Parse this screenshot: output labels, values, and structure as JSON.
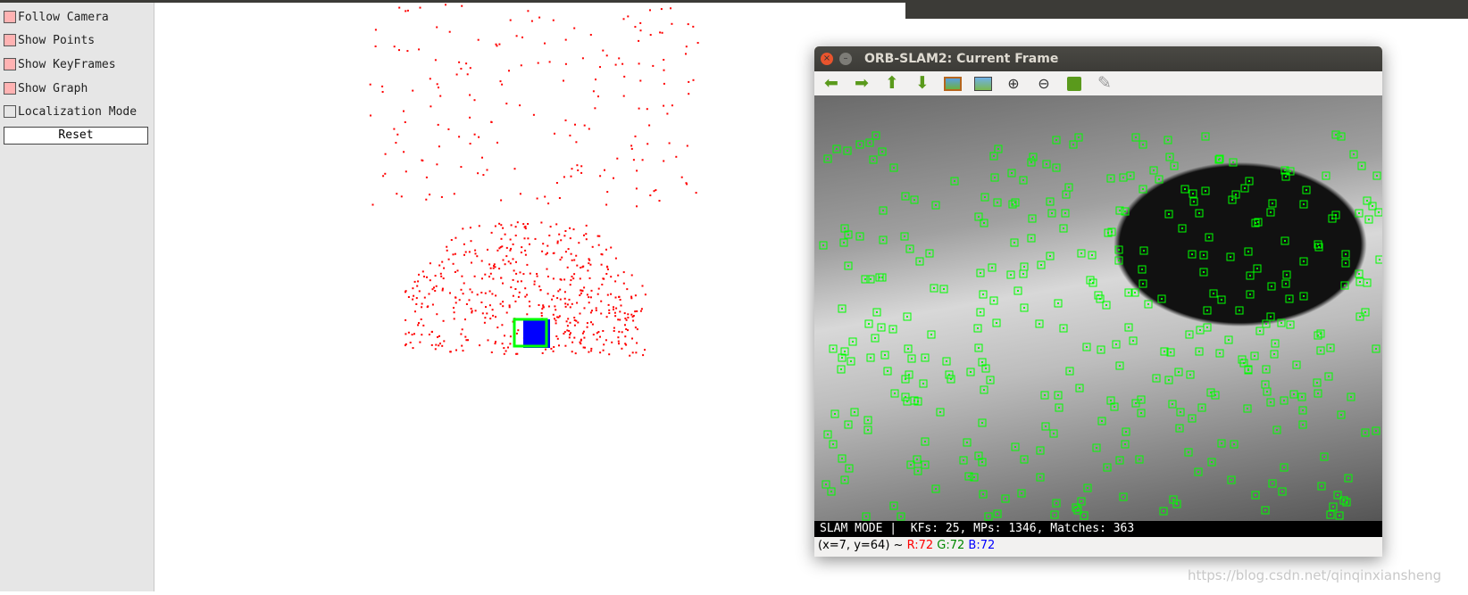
{
  "panel": {
    "options": [
      {
        "label": "Follow Camera",
        "checked": true
      },
      {
        "label": "Show Points",
        "checked": true
      },
      {
        "label": "Show KeyFrames",
        "checked": true
      },
      {
        "label": "Show Graph",
        "checked": true
      },
      {
        "label": "Localization Mode",
        "checked": false
      }
    ],
    "reset_label": "Reset"
  },
  "frame_window": {
    "title": "ORB-SLAM2: Current Frame",
    "toolbar": [
      "arrow-left-icon",
      "arrow-right-icon",
      "arrow-up-icon",
      "arrow-down-icon",
      "image-icon",
      "zoom-fit-icon",
      "zoom-in-icon",
      "zoom-out-icon",
      "save-icon",
      "brush-icon"
    ],
    "slam_bar": "SLAM MODE |  KFs: 25, MPs: 1346, Matches: 363",
    "status": {
      "coords": "(x=7, y=64) ~",
      "r": "R:72",
      "g": "G:72",
      "b": "B:72"
    },
    "colors": {
      "features": "#00ff00",
      "r": "#ff0000",
      "g": "#008800",
      "b": "#0000ff"
    }
  },
  "map_colors": {
    "points": "#ff0000",
    "keyframes": "#0000ff",
    "current_camera": "#00ff00"
  },
  "watermark": "https://blog.csdn.net/qinqinxiansheng"
}
